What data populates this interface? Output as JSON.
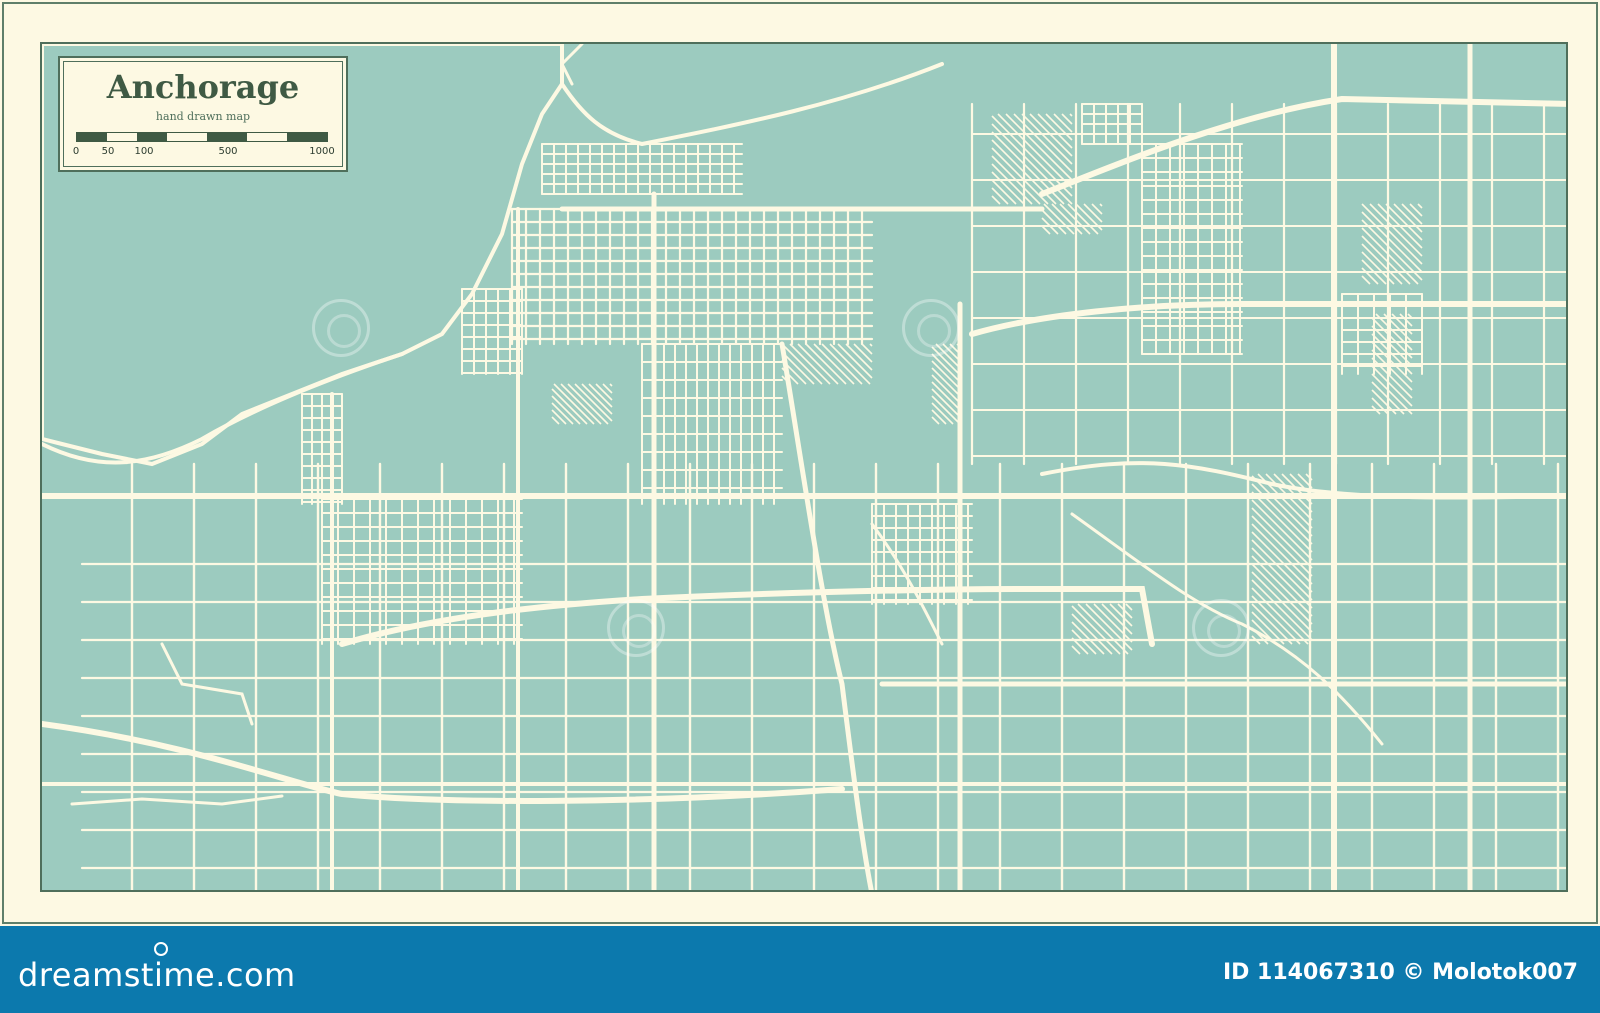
{
  "map": {
    "title": "Anchorage",
    "subtitle": "hand drawn map",
    "scale_ticks": [
      "0",
      "50",
      "100",
      "500",
      "1000"
    ],
    "colors": {
      "water": "#9ccbbf",
      "land": "#9ccbbf",
      "roads": "#fdf9e3",
      "frame": "#4f6f5b",
      "paper": "#fdf9e3",
      "scale_dark": "#3f5a44",
      "scale_light": "#fdf9e3"
    }
  },
  "footer": {
    "brand": "dreamstime.com",
    "id_text": "ID 114067310 © Molotok007",
    "background": "#0c79ad"
  },
  "watermark": {
    "icon": "dreamstime-swirl-icon"
  }
}
